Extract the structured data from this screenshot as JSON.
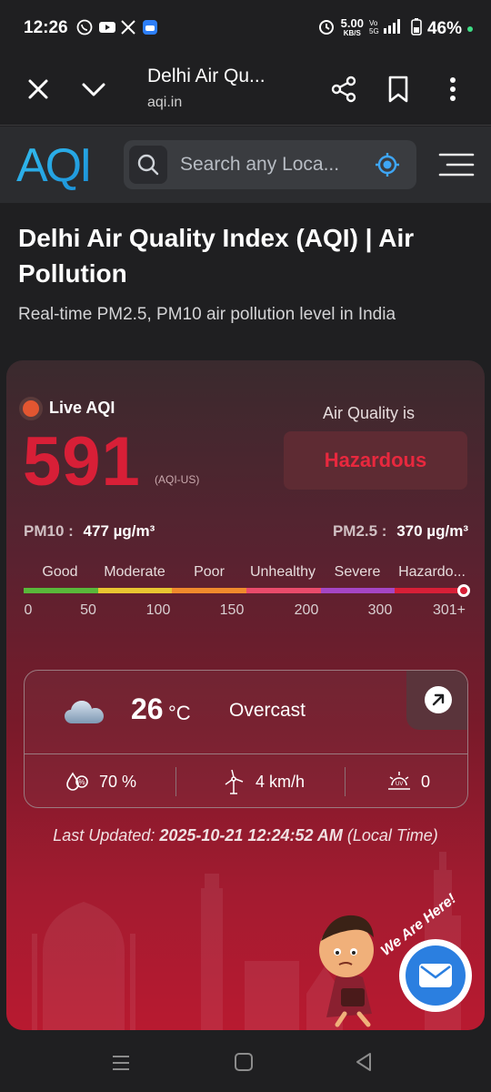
{
  "status_bar": {
    "time": "12:26",
    "speed_value": "5.00",
    "speed_unit": "KB/S",
    "battery": "46%"
  },
  "browser": {
    "title": "Delhi Air Qu...",
    "url": "aqi.in"
  },
  "site": {
    "logo_text": "AQI",
    "search_placeholder": "Search any Loca..."
  },
  "page": {
    "title": "Delhi Air Quality Index (AQI) | Air Pollution",
    "subtitle": "Real-time PM2.5, PM10 air pollution level in India"
  },
  "aqi": {
    "live_label": "Live AQI",
    "value": "591",
    "unit": "(AQI-US)",
    "air_quality_label": "Air Quality is",
    "status": "Hazardous",
    "pm10_label": "PM10 :",
    "pm10_value": "477 µg/m³",
    "pm25_label": "PM2.5 :",
    "pm25_value": "370 µg/m³",
    "scale_categories": [
      "Good",
      "Moderate",
      "Poor",
      "Unhealthy",
      "Severe",
      "Hazardo..."
    ],
    "scale_colors": [
      "#59b83a",
      "#e8c531",
      "#ef8a2c",
      "#e94b6b",
      "#a546c4",
      "#d81f37"
    ],
    "scale_numbers": [
      "0",
      "50",
      "100",
      "150",
      "200",
      "300",
      "301+"
    ],
    "accent_color": "#d81f37"
  },
  "weather": {
    "temperature": "26",
    "temperature_unit": "°C",
    "condition": "Overcast",
    "humidity": "70 %",
    "wind": "4 km/h",
    "uv": "0"
  },
  "last_updated": {
    "label": "Last Updated:",
    "value": "2025-10-21 12:24:52 AM",
    "suffix": "(Local Time)"
  },
  "widget": {
    "we_are_here": "We Are Here!"
  }
}
